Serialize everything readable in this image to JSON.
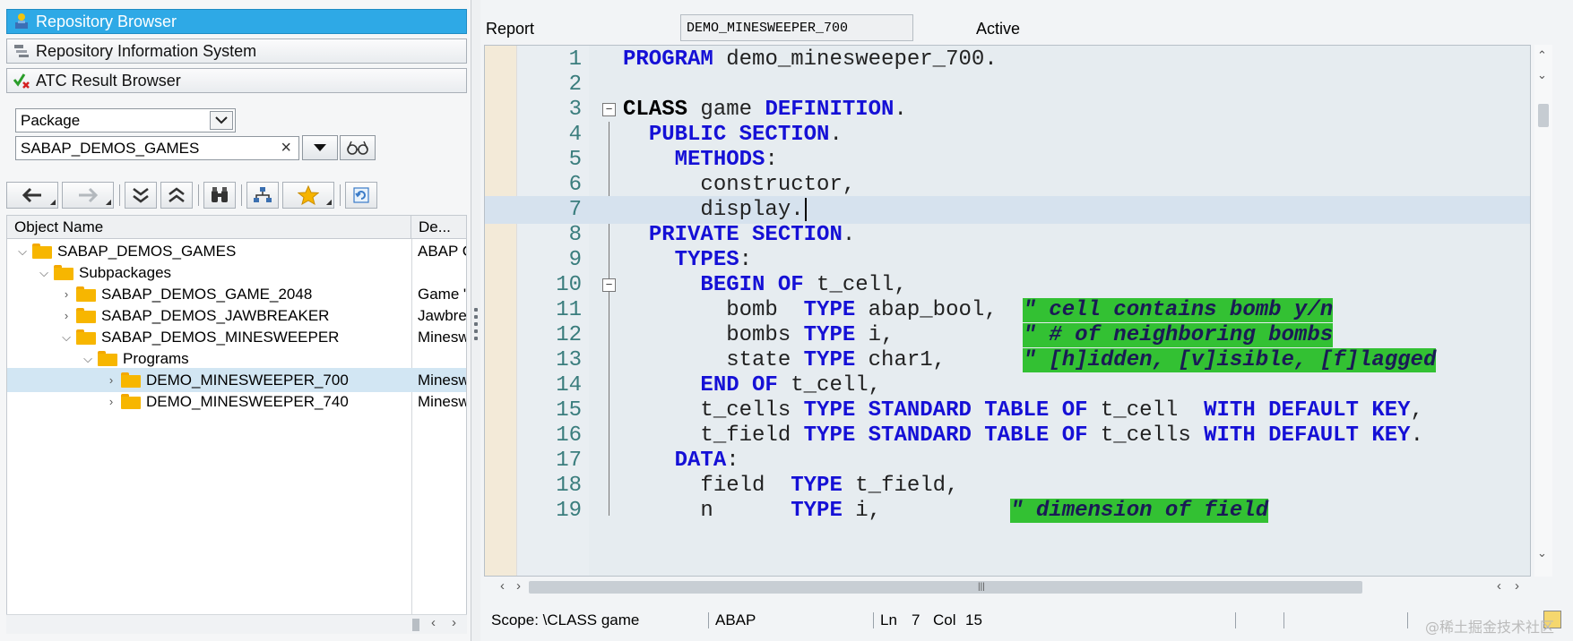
{
  "nav": {
    "repository_browser": "Repository Browser",
    "repository_info": "Repository Information System",
    "atc_browser": "ATC Result Browser"
  },
  "selector": {
    "type_value": "Package",
    "package_value": "SABAP_DEMOS_GAMES",
    "clear_symbol": "×"
  },
  "tree": {
    "col_object_name": "Object Name",
    "col_description": "De...",
    "rows": [
      {
        "label": "SABAP_DEMOS_GAMES",
        "desc": "ABAP G"
      },
      {
        "label": "Subpackages",
        "desc": ""
      },
      {
        "label": "SABAP_DEMOS_GAME_2048",
        "desc": "Game \""
      },
      {
        "label": "SABAP_DEMOS_JAWBREAKER",
        "desc": "Jawbrea"
      },
      {
        "label": "SABAP_DEMOS_MINESWEEPER",
        "desc": "Minesw"
      },
      {
        "label": "Programs",
        "desc": ""
      },
      {
        "label": "DEMO_MINESWEEPER_700",
        "desc": "Minesw"
      },
      {
        "label": "DEMO_MINESWEEPER_740",
        "desc": "Minesw"
      }
    ]
  },
  "editor_header": {
    "type_label": "Report",
    "object_name": "DEMO_MINESWEEPER_700",
    "status": "Active"
  },
  "code": {
    "line_numbers": [
      "1",
      "2",
      "3",
      "4",
      "5",
      "6",
      "7",
      "8",
      "9",
      "10",
      "11",
      "12",
      "13",
      "14",
      "15",
      "16",
      "17",
      "18",
      "19"
    ],
    "l1": {
      "kw": "PROGRAM",
      "rest": " demo_minesweeper_700."
    },
    "l3": {
      "kw1": "CLASS",
      "mid": " game ",
      "kw2": "DEFINITION",
      "end": "."
    },
    "l4": {
      "kw": "PUBLIC SECTION",
      "end": "."
    },
    "l5": {
      "kw": "METHODS",
      "end": ":"
    },
    "l6": {
      "text": "constructor,"
    },
    "l7": {
      "text": "display."
    },
    "l8": {
      "kw": "PRIVATE SECTION",
      "end": "."
    },
    "l9": {
      "kw": "TYPES",
      "end": ":"
    },
    "l10": {
      "kw": "BEGIN OF",
      "rest": " t_cell,"
    },
    "l11": {
      "a": "bomb  ",
      "kw": "TYPE",
      "b": " abap_bool,  ",
      "cm": "\" cell contains bomb y/n"
    },
    "l12": {
      "a": "bombs ",
      "kw": "TYPE",
      "b": " i,          ",
      "cm": "\" # of neighboring bombs"
    },
    "l13": {
      "a": "state ",
      "kw": "TYPE",
      "b": " char1,      ",
      "cm": "\" [h]idden, [v]isible, [f]lagged"
    },
    "l14": {
      "kw": "END OF",
      "rest": " t_cell,"
    },
    "l15": {
      "a": "t_cells ",
      "kw1": "TYPE STANDARD TABLE OF",
      "b": " t_cell  ",
      "kw2": "WITH DEFAULT KEY",
      "end": ","
    },
    "l16": {
      "a": "t_field ",
      "kw1": "TYPE STANDARD TABLE OF",
      "b": " t_cells ",
      "kw2": "WITH DEFAULT KEY",
      "end": "."
    },
    "l17": {
      "kw": "DATA",
      "end": ":"
    },
    "l18": {
      "a": "field  ",
      "kw": "TYPE",
      "b": " t_field,"
    },
    "l19": {
      "a": "n      ",
      "kw": "TYPE",
      "b": " i,          ",
      "cm": "\" dimension of field"
    }
  },
  "status_bar": {
    "scope": "Scope: \\CLASS game",
    "language": "ABAP",
    "ln_label": "Ln",
    "ln_value": "7",
    "col_label": "Col",
    "col_value": "15"
  },
  "watermark": "@稀土掘金技术社区",
  "colors": {
    "accent": "#2ea9e6",
    "keyword": "#1510d6",
    "comment_bg": "#33c133",
    "folder": "#f7b600"
  }
}
